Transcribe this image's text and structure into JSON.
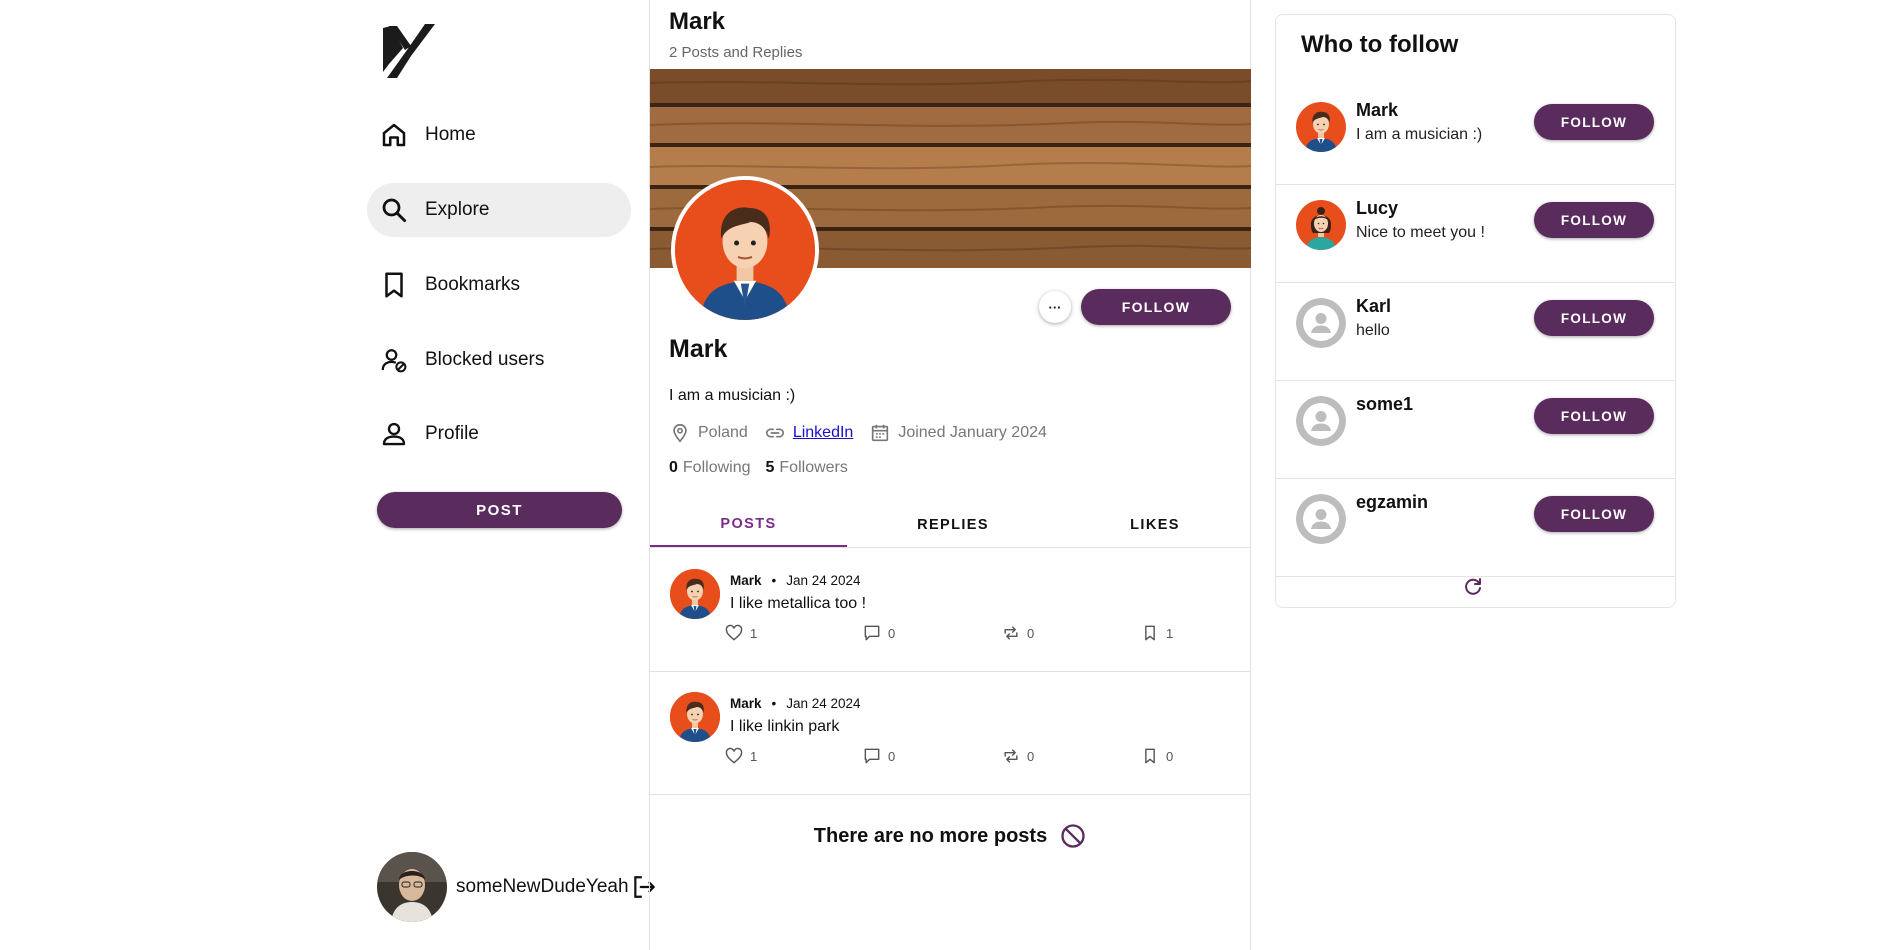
{
  "sidebar": {
    "nav": [
      {
        "label": "Home",
        "icon": "home-icon"
      },
      {
        "label": "Explore",
        "icon": "search-icon"
      },
      {
        "label": "Bookmarks",
        "icon": "bookmark-icon"
      },
      {
        "label": "Blocked users",
        "icon": "blocked-user-icon"
      },
      {
        "label": "Profile",
        "icon": "person-icon"
      }
    ],
    "active": "Explore",
    "post_button": "POST",
    "current_user": "someNewDudeYeah"
  },
  "header": {
    "name": "Mark",
    "subtitle": "2 Posts and Replies"
  },
  "profile": {
    "name": "Mark",
    "bio": "I am a musician :)",
    "location": "Poland",
    "link": "LinkedIn",
    "joined": "Joined January 2024",
    "following_count": "0",
    "following_label": "Following",
    "followers_count": "5",
    "followers_label": "Followers",
    "more_button": "···",
    "follow_button": "FOLLOW"
  },
  "tabs": [
    {
      "label": "POSTS",
      "active": true
    },
    {
      "label": "REPLIES",
      "active": false
    },
    {
      "label": "LIKES",
      "active": false
    }
  ],
  "posts": [
    {
      "author": "Mark",
      "date": "Jan 24 2024",
      "text": "I like metallica too !",
      "likes": "1",
      "comments": "0",
      "reposts": "0",
      "bookmarks": "1"
    },
    {
      "author": "Mark",
      "date": "Jan 24 2024",
      "text": "I like linkin park",
      "likes": "1",
      "comments": "0",
      "reposts": "0",
      "bookmarks": "0"
    }
  ],
  "end_message": "There are no more posts",
  "who_to_follow": {
    "title": "Who to follow",
    "users": [
      {
        "name": "Mark",
        "bio": "I am a musician :)",
        "button": "FOLLOW"
      },
      {
        "name": "Lucy",
        "bio": "Nice to meet you !",
        "button": "FOLLOW"
      },
      {
        "name": "Karl",
        "bio": "hello",
        "button": "FOLLOW"
      },
      {
        "name": "some1",
        "bio": "",
        "button": "FOLLOW"
      },
      {
        "name": "egzamin",
        "bio": "",
        "button": "FOLLOW"
      }
    ]
  },
  "colors": {
    "accent": "#5a2b5d",
    "tab_active": "#7b2c8a",
    "avatar_orange": "#e84e1b",
    "link": "#1a0dcc"
  }
}
